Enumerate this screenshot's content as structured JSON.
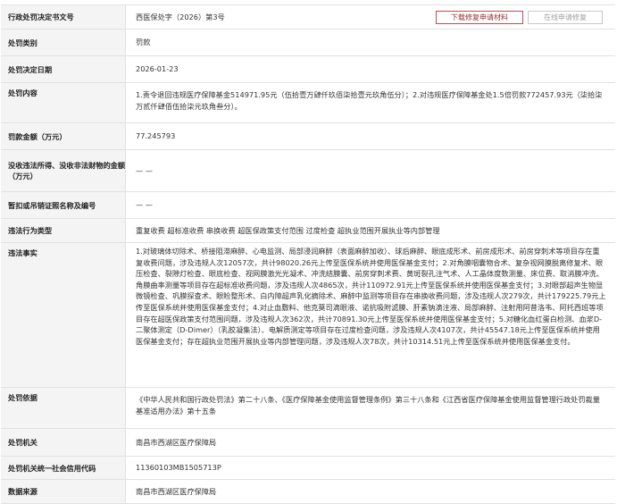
{
  "rows": {
    "decision_no": {
      "label": "行政处罚决定书文号",
      "value": "西医保处字（2026）第3号"
    },
    "punish_type": {
      "label": "处罚类别",
      "value": "罚款"
    },
    "decision_date": {
      "label": "处罚决定日期",
      "value": "2026-01-23"
    },
    "content": {
      "label": "处罚内容",
      "value": "1.责令退回违规医疗保障基金514971.95元（伍拾壹万肆仟玖佰柒拾壹元玖角伍分）；2.对违规医疗保障基金处1.5倍罚款772457.93元（柒拾柒万贰仟肆佰伍拾柒元玖角叁分）。"
    },
    "amount": {
      "label": "罚款金额（万元）",
      "value": "77.245793"
    },
    "confiscated": {
      "label": "没收违法所得、没收非法财物的金额（万元）",
      "value": "— —"
    },
    "license_no": {
      "label": "暂扣或吊销证照名称及编号",
      "value": "— —"
    },
    "violation_type": {
      "label": "违法行为类型",
      "value": "重复收费 超标准收费 串换收费 超医保政策支付范围 过度检查 超执业范围开展执业等内部管理"
    },
    "facts": {
      "label": "违法事实",
      "value": "1.对玻璃体切除术、桥接阻滞麻醉、心电监测、局部浸润麻醉（表面麻醉加收）、球后麻醉、眼底成形术、前房成形术、前房穿刺术等项目存在重复收费问题，涉及违规人次12057次，共计98020.26元上传至医保系统并使用医保基金支付；2.对角膜咽囊物合术、复杂视网膜脱离修复术、眼压检查、裂隙灯检查、眼底检查、视网膜激光光凝术、冲洗结膜囊、前房穿刺术费、黄斑裂孔注气术、人工晶体度数测量、床位费、取消膜冲洗、角膜曲率测量等项目存在超标准收费问题，涉及违规人次4865次，共计110972.91元上传至医保系统并使用医保基金支付；3.对眼部超声生物显微镜检查、巩膜探查术、眼睑整形术、白内障超声乳化摘除术、麻醉中监测等项目存在串换收费问题，涉及违规人次279次，共计179225.79元上传至医保系统并使用医保基金支付；4.对止血敷料、他克莫司滴眼液、诺抗吸附滤膜、肝素钠滴注液、局部麻醉、注射用阿昔洛韦、阿托西班等项目存在超医保政策支付范围问题，涉及违规人次362次，共计70891.30元上传至医保系统并使用医保基金支付；5.对糖化血红蛋白检测、血浆D-二聚体测定（D-Dimer）（乳胶凝集法）、电解质测定等项目存在过度检查问题，涉及违规人次4107次，共计45547.18元上传至医保系统并使用医保基金支付；存在超执业范围开展执业等内部管理问题，涉及违规人次78次，共计10314.51元上传至医保系统并使用医保基金支付。"
    },
    "basis": {
      "label": "处罚依据",
      "value": "《中华人民共和国行政处罚法》第二十八条、《医疗保障基金使用监督管理条例》第三十八条和《江西省医疗保障基金使用监督管理行政处罚裁量基准适用办法》第十五条"
    },
    "authority": {
      "label": "处罚机关",
      "value": "南昌市西湖区医疗保障局"
    },
    "credit_code": {
      "label": "处罚机关统一社会信用代码",
      "value": "11360103MB1505713P"
    },
    "source": {
      "label": "数据来源",
      "value": "南昌市西湖区医疗保障局"
    }
  },
  "buttons": {
    "download_repair": "下载修复申请材料",
    "online_repair": "在线申请修复"
  },
  "colors": {
    "label_bg": "#f4f4f4",
    "border": "#e2e2e2",
    "download_button": "#9a2d2d"
  }
}
